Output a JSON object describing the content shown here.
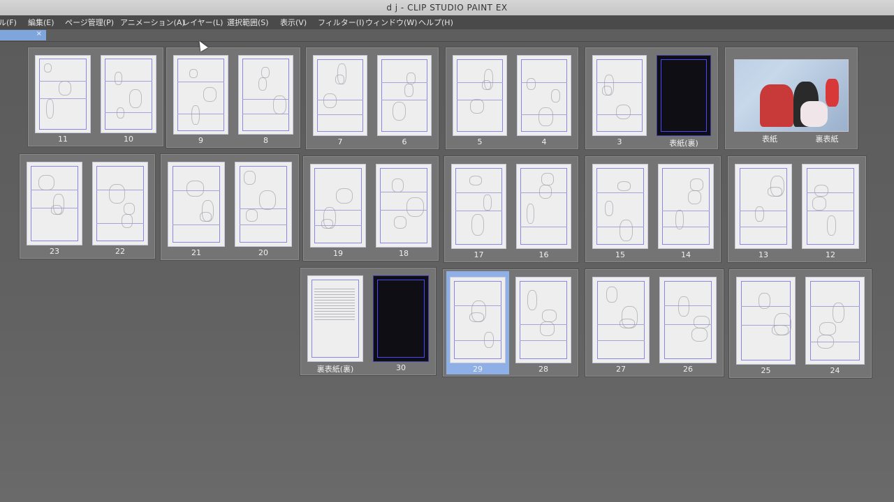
{
  "window": {
    "title": "d j  - CLIP STUDIO PAINT EX"
  },
  "menu": {
    "items": [
      "ル(F)",
      "編集(E)",
      "ページ管理(P)",
      "アニメーション(A)",
      "レイヤー(L)",
      "選択範囲(S)",
      "表示(V)",
      "フィルター(I)",
      "ウィンドウ(W)",
      "ヘルプ(H)"
    ]
  },
  "tab": {
    "close_label": "×"
  },
  "colors": {
    "canvas_bg": "#5b5b5b",
    "selection": "#8fb0e6",
    "frame": "#8a86e6"
  },
  "spreads": [
    {
      "pages": [
        {
          "label": "11",
          "kind": "sketch"
        },
        {
          "label": "10",
          "kind": "sketch"
        }
      ]
    },
    {
      "pages": [
        {
          "label": "9",
          "kind": "sketch"
        },
        {
          "label": "8",
          "kind": "sketch"
        }
      ]
    },
    {
      "pages": [
        {
          "label": "7",
          "kind": "sketch"
        },
        {
          "label": "6",
          "kind": "sketch"
        }
      ]
    },
    {
      "pages": [
        {
          "label": "5",
          "kind": "sketch"
        },
        {
          "label": "4",
          "kind": "sketch"
        }
      ]
    },
    {
      "pages": [
        {
          "label": "3",
          "kind": "sketch"
        },
        {
          "label": "表紙(裏)",
          "kind": "dark"
        }
      ]
    },
    {
      "pages": [
        {
          "label": "表紙",
          "kind": "cover"
        },
        {
          "label": "裏表紙",
          "kind": "cover"
        }
      ],
      "merged": true
    },
    {
      "pages": [
        {
          "label": "23",
          "kind": "sketch"
        },
        {
          "label": "22",
          "kind": "sketch"
        }
      ]
    },
    {
      "pages": [
        {
          "label": "21",
          "kind": "sketch"
        },
        {
          "label": "20",
          "kind": "sketch"
        }
      ]
    },
    {
      "pages": [
        {
          "label": "19",
          "kind": "sketch"
        },
        {
          "label": "18",
          "kind": "sketch"
        }
      ]
    },
    {
      "pages": [
        {
          "label": "17",
          "kind": "sketch"
        },
        {
          "label": "16",
          "kind": "sketch"
        }
      ]
    },
    {
      "pages": [
        {
          "label": "15",
          "kind": "sketch"
        },
        {
          "label": "14",
          "kind": "sketch"
        }
      ]
    },
    {
      "pages": [
        {
          "label": "13",
          "kind": "sketch"
        },
        {
          "label": "12",
          "kind": "sketch"
        }
      ]
    },
    {
      "pages": [
        {
          "label": "裏表紙(裏)",
          "kind": "text"
        },
        {
          "label": "30",
          "kind": "dark"
        }
      ]
    },
    {
      "pages": [
        {
          "label": "29",
          "kind": "sketch",
          "selected": true
        },
        {
          "label": "28",
          "kind": "sketch"
        }
      ]
    },
    {
      "pages": [
        {
          "label": "27",
          "kind": "sketch"
        },
        {
          "label": "26",
          "kind": "sketch"
        }
      ]
    },
    {
      "pages": [
        {
          "label": "25",
          "kind": "sketch"
        },
        {
          "label": "24",
          "kind": "sketch"
        }
      ]
    }
  ]
}
